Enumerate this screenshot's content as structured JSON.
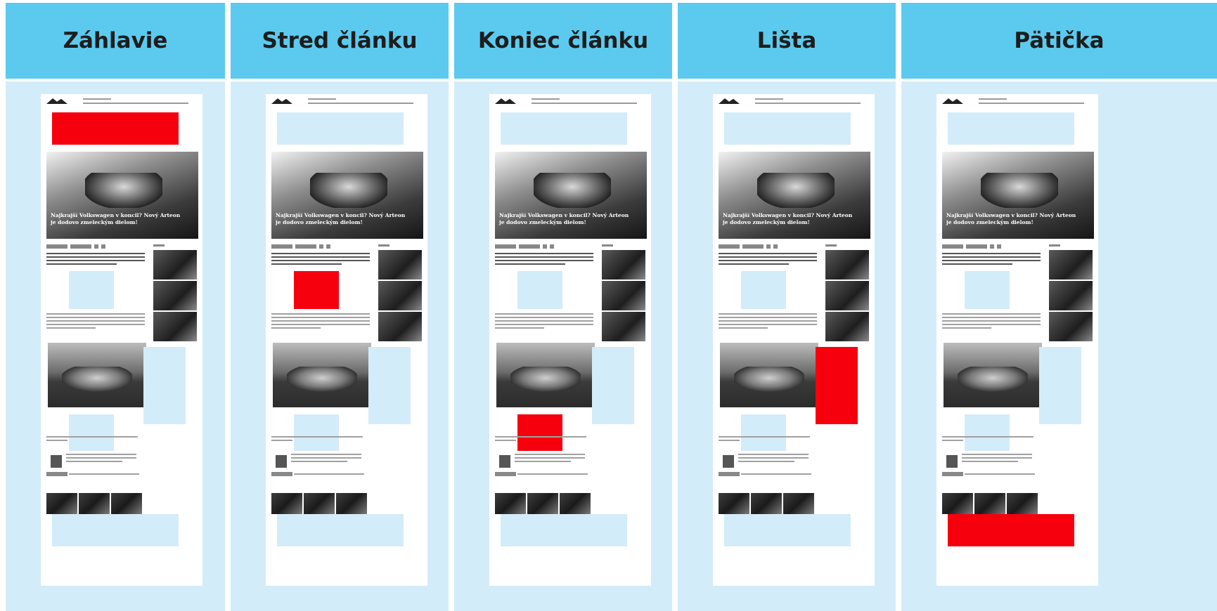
{
  "columns": [
    {
      "id": "zahlavie",
      "label": "Záhlavie",
      "active_slot": "header"
    },
    {
      "id": "stred",
      "label": "Stred článku",
      "active_slot": "mid"
    },
    {
      "id": "koniec",
      "label": "Koniec článku",
      "active_slot": "end"
    },
    {
      "id": "lista",
      "label": "Lišta",
      "active_slot": "sidebar"
    },
    {
      "id": "paticka",
      "label": "Pätička",
      "active_slot": "footer"
    }
  ],
  "mockup": {
    "hero_title": "Najkrajší Volkswagen v koncil? Nový Arteon je dodovo zmeleckým dielom!"
  },
  "colors": {
    "header_bg": "#5ccaef",
    "body_bg": "#d3ecf9",
    "active_slot": "#f7000d",
    "inactive_slot": "#d3ecf9"
  }
}
